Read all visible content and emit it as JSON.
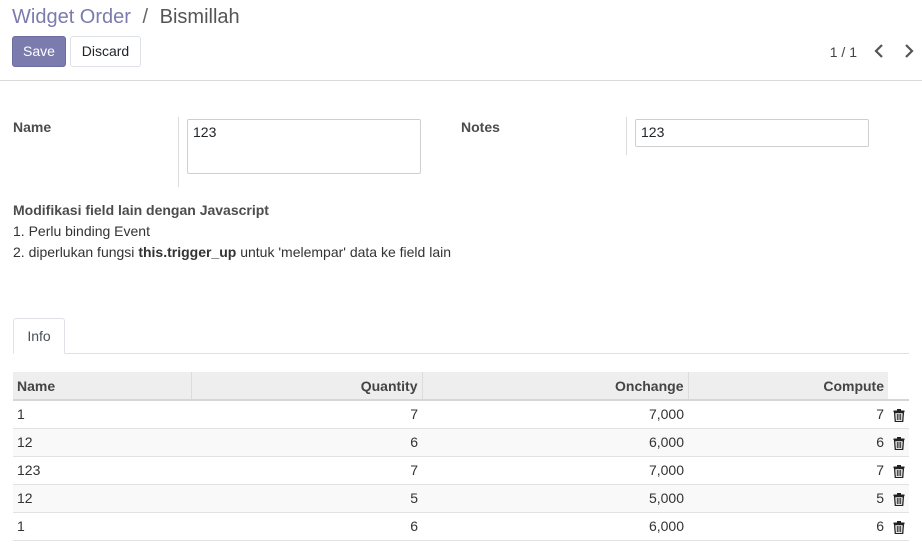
{
  "breadcrumb": {
    "parent": "Widget Order",
    "separator": "/",
    "current": "Bismillah"
  },
  "toolbar": {
    "save_label": "Save",
    "discard_label": "Discard"
  },
  "pager": {
    "value": "1 / 1",
    "prev_icon": "chevron-left-icon",
    "next_icon": "chevron-right-icon"
  },
  "form": {
    "name_label": "Name",
    "name_value": "123",
    "notes_label": "Notes",
    "notes_value": "123"
  },
  "info": {
    "title": "Modifikasi field lain dengan Javascript",
    "line1": "1. Perlu binding Event",
    "line2_prefix": "2. diperlukan fungsi ",
    "line2_bold": "this.trigger_up",
    "line2_suffix": " untuk 'melempar' data ke field lain"
  },
  "tabs": [
    {
      "label": "Info"
    }
  ],
  "table": {
    "headers": [
      "Name",
      "Quantity",
      "Onchange",
      "Compute"
    ],
    "rows": [
      [
        "1",
        "7",
        "7,000",
        "7"
      ],
      [
        "12",
        "6",
        "6,000",
        "6"
      ],
      [
        "123",
        "7",
        "7,000",
        "7"
      ],
      [
        "12",
        "5",
        "5,000",
        "5"
      ],
      [
        "1",
        "6",
        "6,000",
        "6"
      ]
    ],
    "row_action_icon": "trash-icon"
  },
  "colors": {
    "primary": "#7c7bad"
  }
}
